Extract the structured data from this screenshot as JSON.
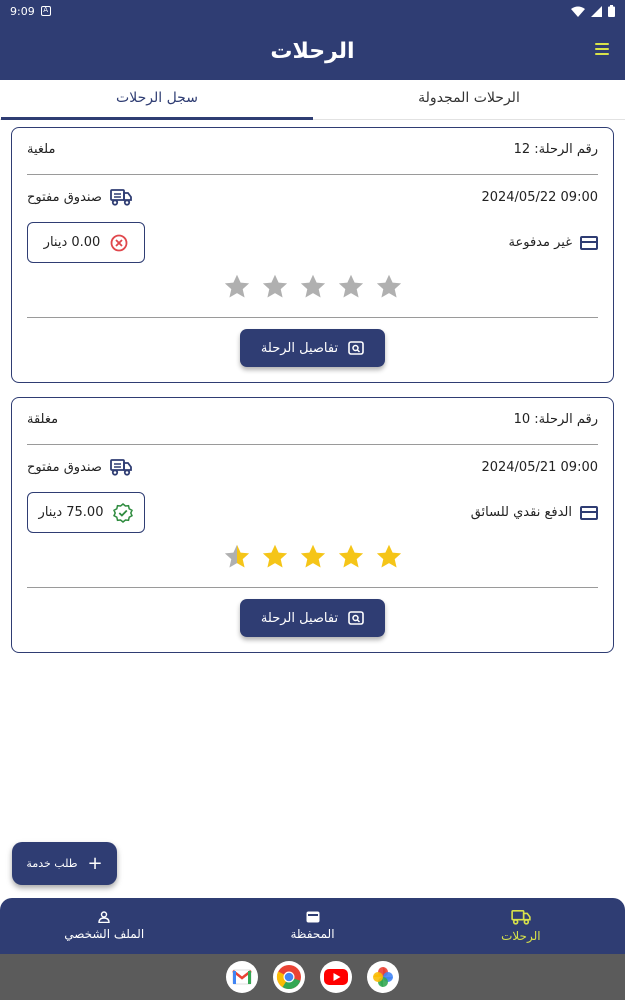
{
  "status_bar": {
    "time": "9:09",
    "notification_glyph": "A"
  },
  "app_bar": {
    "title": "الرحلات"
  },
  "tabs": [
    {
      "label": "الرحلات المجدولة",
      "active": false
    },
    {
      "label": "سجل الرحلات",
      "active": true
    }
  ],
  "trips": [
    {
      "trip_number": "رقم الرحلة: 12",
      "status": "ملغية",
      "datetime": "09:00 2024/05/22",
      "box_type": "صندوق مفتوح",
      "payment_method": "غير مدفوعة",
      "amount": "0.00 دينار",
      "amount_state": "cancelled",
      "rating": 0,
      "details_label": "تفاصيل الرحلة"
    },
    {
      "trip_number": "رقم الرحلة: 10",
      "status": "مغلقة",
      "datetime": "09:00 2024/05/21",
      "box_type": "صندوق مفتوح",
      "payment_method": "الدفع نقدي للسائق",
      "amount": "75.00 دينار",
      "amount_state": "paid",
      "rating": 4.5,
      "details_label": "تفاصيل الرحلة"
    }
  ],
  "fab": {
    "label": "طلب خدمة"
  },
  "bottom_nav": [
    {
      "label": "الرحلات",
      "icon": "truck-icon",
      "active": true
    },
    {
      "label": "المحفظة",
      "icon": "wallet-icon",
      "active": false
    },
    {
      "label": "الملف الشخصي",
      "icon": "person-icon",
      "active": false
    }
  ],
  "dock": [
    "gmail-icon",
    "chrome-icon",
    "youtube-icon",
    "photos-icon"
  ],
  "colors": {
    "primary": "#2f3d73",
    "accent": "#d8e24a",
    "star_filled": "#f5c518",
    "star_empty": "#b0b0b0",
    "error": "#e0474c",
    "success": "#2e8b3e"
  }
}
